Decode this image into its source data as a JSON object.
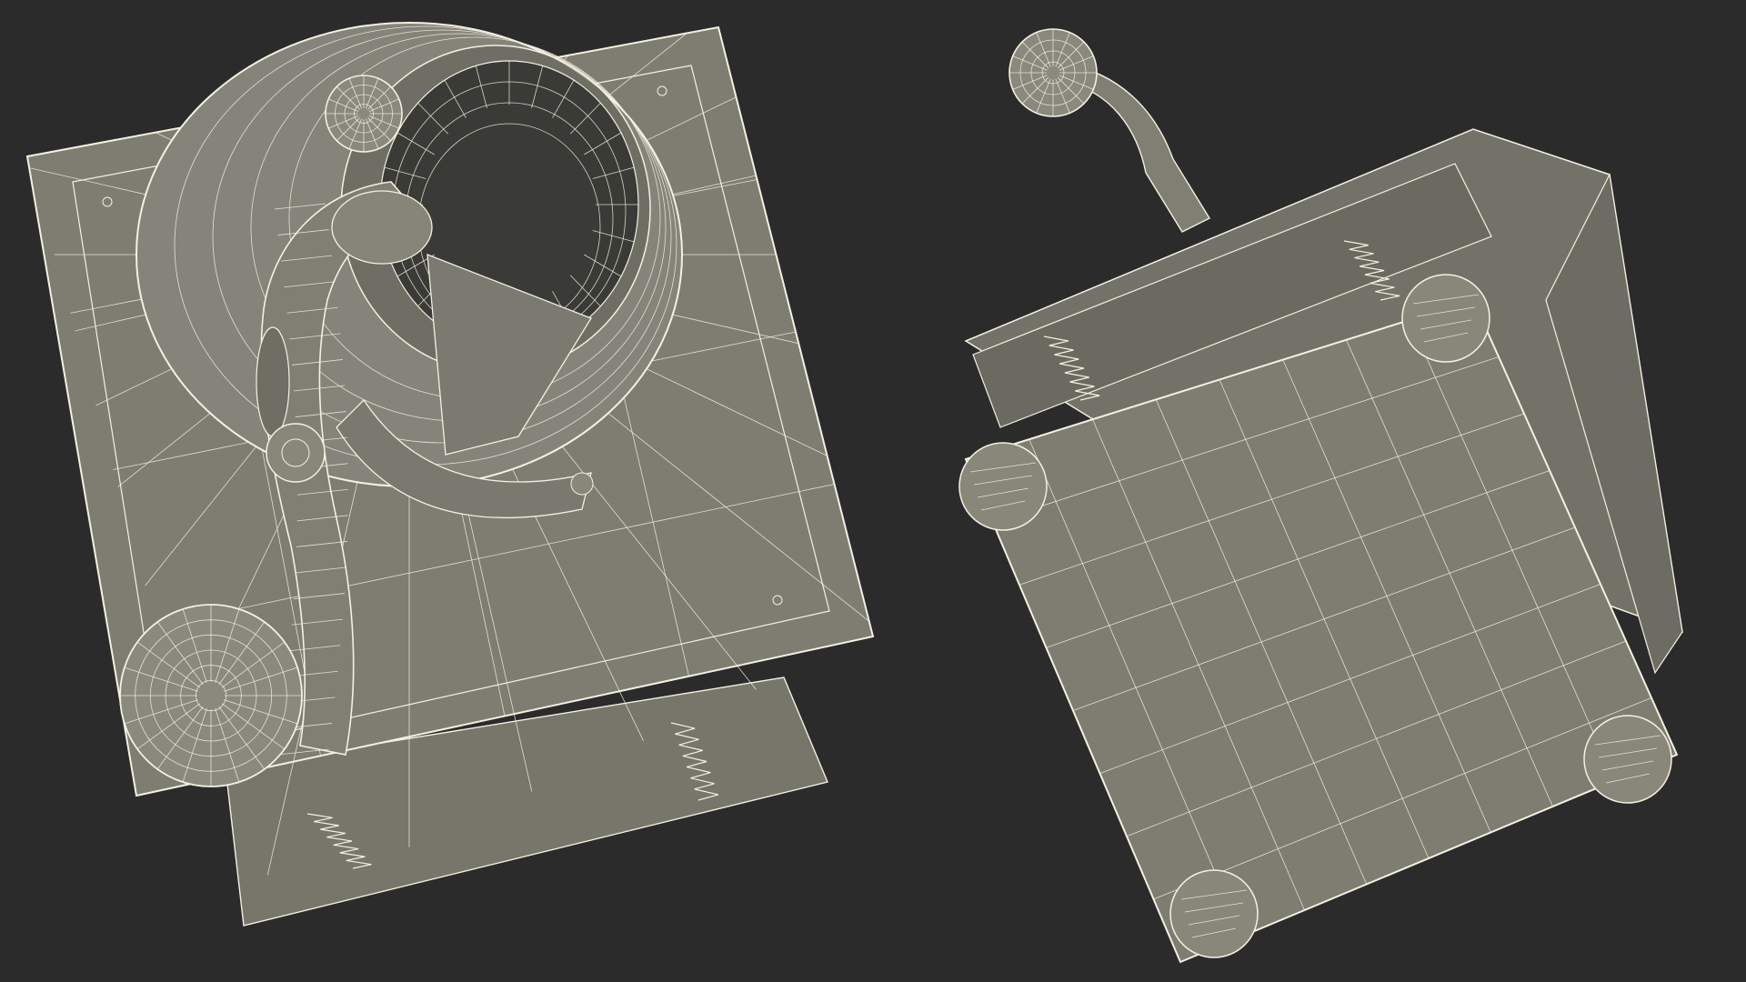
{
  "scene": {
    "background_color": "#2b2b2b",
    "surface_color": "#7e7d72",
    "surface_dark_color": "#5f5e55",
    "wire_color": "#f4f1e2",
    "inner_dark_color": "#3a3a36",
    "views": [
      {
        "id": "top-view",
        "subject": "coffee-grinder-top"
      },
      {
        "id": "bottom-view",
        "subject": "coffee-grinder-bottom"
      }
    ]
  }
}
